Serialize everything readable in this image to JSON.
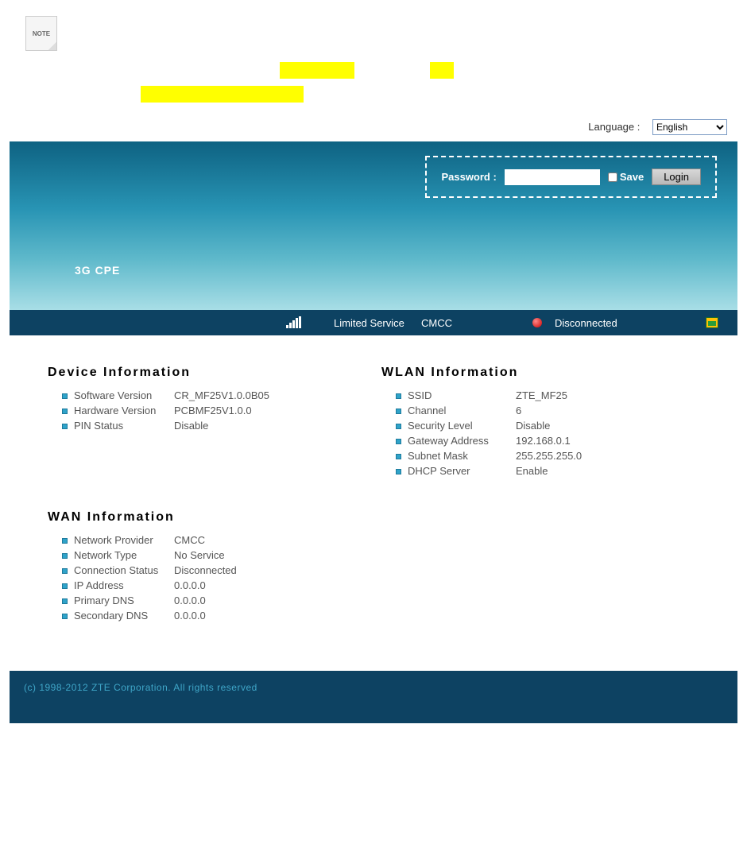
{
  "note": {
    "icon_text": "NOTE"
  },
  "language": {
    "label": "Language :",
    "value": "English",
    "options": [
      "English"
    ]
  },
  "login": {
    "password_label": "Password :",
    "save_label": "Save",
    "login_button": "Login"
  },
  "brand": "3G CPE",
  "status_bar": {
    "service": "Limited Service",
    "carrier": "CMCC",
    "connection": "Disconnected"
  },
  "sections": {
    "device": {
      "title": "Device Information",
      "rows": [
        {
          "label": "Software Version",
          "value": "CR_MF25V1.0.0B05"
        },
        {
          "label": "Hardware Version",
          "value": "PCBMF25V1.0.0"
        },
        {
          "label": "PIN Status",
          "value": "Disable"
        }
      ]
    },
    "wlan": {
      "title": "WLAN Information",
      "rows": [
        {
          "label": "SSID",
          "value": "ZTE_MF25"
        },
        {
          "label": "Channel",
          "value": "6"
        },
        {
          "label": "Security Level",
          "value": "Disable"
        },
        {
          "label": "Gateway Address",
          "value": "192.168.0.1"
        },
        {
          "label": "Subnet Mask",
          "value": "255.255.255.0"
        },
        {
          "label": "DHCP Server",
          "value": "Enable"
        }
      ]
    },
    "wan": {
      "title": "WAN Information",
      "rows": [
        {
          "label": "Network Provider",
          "value": "CMCC"
        },
        {
          "label": "Network Type",
          "value": "No Service"
        },
        {
          "label": "Connection Status",
          "value": "Disconnected"
        },
        {
          "label": "IP Address",
          "value": "0.0.0.0"
        },
        {
          "label": "Primary DNS",
          "value": "0.0.0.0"
        },
        {
          "label": "Secondary DNS",
          "value": "0.0.0.0"
        }
      ]
    }
  },
  "footer": "(c) 1998-2012 ZTE Corporation. All rights reserved"
}
